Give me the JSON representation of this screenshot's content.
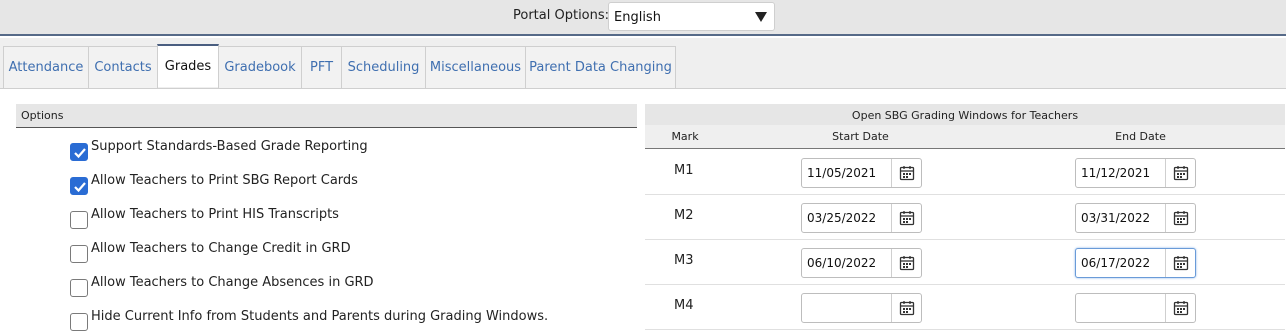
{
  "portal": {
    "label": "Portal Options:",
    "selected": "English"
  },
  "tabs": [
    {
      "label": "Attendance",
      "active": false
    },
    {
      "label": "Contacts",
      "active": false
    },
    {
      "label": "Grades",
      "active": true
    },
    {
      "label": "Gradebook",
      "active": false
    },
    {
      "label": "PFT",
      "active": false
    },
    {
      "label": "Scheduling",
      "active": false
    },
    {
      "label": "Miscellaneous",
      "active": false
    },
    {
      "label": "Parent Data Changing",
      "active": false
    }
  ],
  "options": {
    "title": "Options",
    "items": [
      {
        "label": "Support Standards-Based Grade Reporting",
        "checked": true
      },
      {
        "label": "Allow Teachers to Print SBG Report Cards",
        "checked": true
      },
      {
        "label": "Allow Teachers to Print HIS Transcripts",
        "checked": false
      },
      {
        "label": "Allow Teachers to Change Credit in GRD",
        "checked": false
      },
      {
        "label": "Allow Teachers to Change Absences in GRD",
        "checked": false
      },
      {
        "label": "Hide Current Info from Students and Parents during Grading Windows.",
        "checked": false
      }
    ]
  },
  "windows": {
    "title": "Open SBG Grading Windows for Teachers",
    "columns": {
      "mark": "Mark",
      "start": "Start Date",
      "end": "End Date"
    },
    "rows": [
      {
        "mark": "M1",
        "start": "11/05/2021",
        "end": "11/12/2021"
      },
      {
        "mark": "M2",
        "start": "03/25/2022",
        "end": "03/31/2022"
      },
      {
        "mark": "M3",
        "start": "06/10/2022",
        "end": "06/17/2022"
      },
      {
        "mark": "M4",
        "start": "",
        "end": ""
      }
    ]
  },
  "colors": {
    "accent": "#2a6cd4",
    "tab_link": "#3f6fb0",
    "header_rule": "#566a88"
  }
}
